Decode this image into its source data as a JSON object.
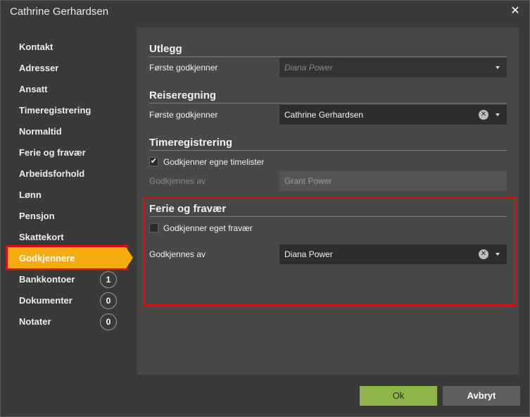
{
  "window": {
    "title": "Cathrine Gerhardsen"
  },
  "sidebar": {
    "items": [
      {
        "label": "Kontakt"
      },
      {
        "label": "Adresser"
      },
      {
        "label": "Ansatt"
      },
      {
        "label": "Timeregistrering"
      },
      {
        "label": "Normaltid"
      },
      {
        "label": "Ferie og fravær"
      },
      {
        "label": "Arbeidsforhold"
      },
      {
        "label": "Lønn"
      },
      {
        "label": "Pensjon"
      },
      {
        "label": "Skattekort"
      },
      {
        "label": "Godkjennere",
        "active": true
      },
      {
        "label": "Bankkontoer",
        "count": "1"
      },
      {
        "label": "Dokumenter",
        "count": "0"
      },
      {
        "label": "Notater",
        "count": "0"
      }
    ]
  },
  "utlegg": {
    "title": "Utlegg",
    "first_approver_label": "Første godkjenner",
    "first_approver_value": "Diana Power"
  },
  "reiseregning": {
    "title": "Reiseregning",
    "first_approver_label": "Første godkjenner",
    "first_approver_value": "Cathrine Gerhardsen"
  },
  "timeregistrering": {
    "title": "Timeregistrering",
    "own_timesheets_label": "Godkjenner egne timelister",
    "own_timesheets_checked": true,
    "approved_by_label": "Godkjennes av",
    "approved_by_value": "Grant Power"
  },
  "ferie": {
    "title": "Ferie og fravær",
    "own_absence_label": "Godkjenner eget fravær",
    "own_absence_checked": false,
    "approved_by_label": "Godkjennes av",
    "approved_by_value": "Diana Power"
  },
  "buttons": {
    "ok": "Ok",
    "cancel": "Avbryt"
  },
  "colors": {
    "accent": "#f6ab0f",
    "ok": "#8fb54a",
    "highlight": "#d41010"
  }
}
